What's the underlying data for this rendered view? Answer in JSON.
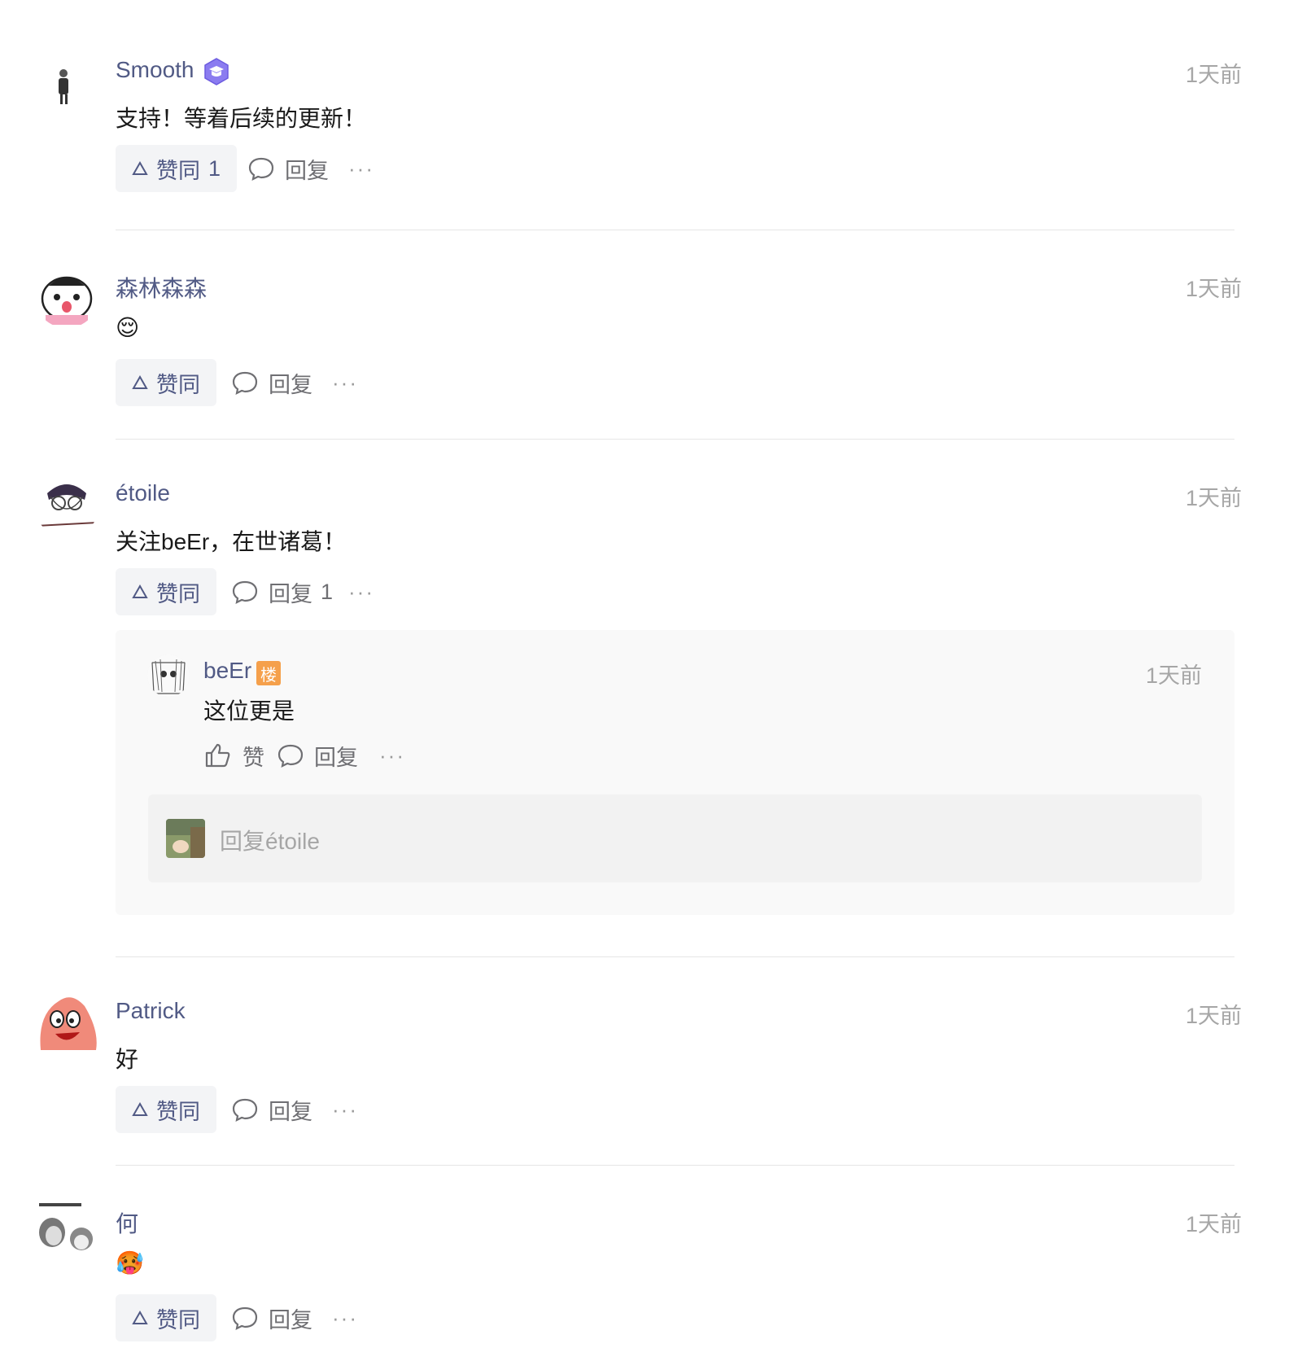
{
  "comments": [
    {
      "name": "Smooth",
      "has_edu_badge": true,
      "time": "1天前",
      "text": "支持！等着后续的更新！",
      "vote_label": "赞同",
      "vote_count": "1",
      "reply_label": "回复",
      "reply_count": "",
      "more": "···"
    },
    {
      "name": "森林森森",
      "time": "1天前",
      "emoji": "😌",
      "vote_label": "赞同",
      "vote_count": "",
      "reply_label": "回复",
      "reply_count": "",
      "more": "···"
    },
    {
      "name": "étoile",
      "time": "1天前",
      "text": "关注beEr，在世诸葛！",
      "vote_label": "赞同",
      "vote_count": "",
      "reply_label": "回复",
      "reply_count": "1",
      "more": "···",
      "sub_reply": {
        "name": "beEr",
        "floor_badge": "楼",
        "time": "1天前",
        "text": "这位更是",
        "like_label": "赞",
        "reply_label": "回复",
        "more": "···",
        "input_placeholder": "回复étoile"
      }
    },
    {
      "name": "Patrick",
      "time": "1天前",
      "text": "好",
      "vote_label": "赞同",
      "vote_count": "",
      "reply_label": "回复",
      "reply_count": "",
      "more": "···"
    },
    {
      "name": "何",
      "time": "1天前",
      "emoji": "🥵",
      "vote_label": "赞同",
      "vote_count": "",
      "reply_label": "回复",
      "reply_count": "",
      "more": "···"
    }
  ],
  "colors": {
    "username": "#515a85",
    "timestamp": "#a6a6a6",
    "vote_bg": "#f3f4f6",
    "floor_badge": "#f5a04b",
    "edu_badge": "#7b68ee"
  },
  "icons": [
    "upvote-triangle-icon",
    "comment-bubble-icon",
    "thumbs-up-icon",
    "more-dots-icon",
    "edu-badge-icon"
  ]
}
